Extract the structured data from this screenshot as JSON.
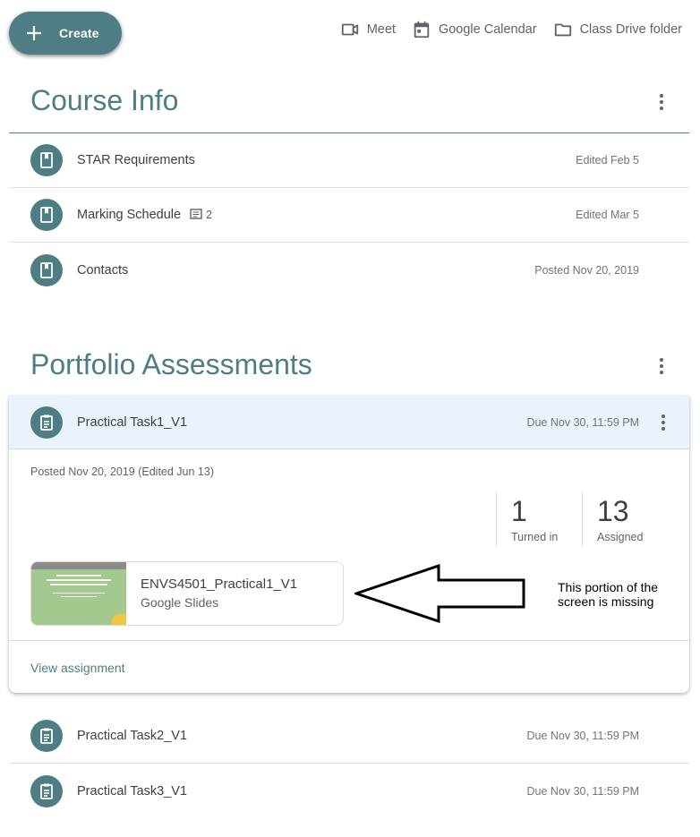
{
  "topbar": {
    "create_label": "Create",
    "links": [
      {
        "label": "Meet",
        "icon": "video-camera-icon"
      },
      {
        "label": "Google Calendar",
        "icon": "calendar-icon"
      },
      {
        "label": "Class Drive folder",
        "icon": "folder-icon"
      }
    ]
  },
  "course_info": {
    "title": "Course Info",
    "items": [
      {
        "title": "STAR Requirements",
        "meta": "Edited Feb 5",
        "comments": ""
      },
      {
        "title": "Marking Schedule",
        "meta": "Edited Mar 5",
        "comments": "2"
      },
      {
        "title": "Contacts",
        "meta": "Posted Nov 20, 2019",
        "comments": ""
      }
    ]
  },
  "portfolio": {
    "title": "Portfolio Assessments",
    "expanded": {
      "title": "Practical Task1_V1",
      "due": "Due Nov 30, 11:59 PM",
      "posted": "Posted Nov 20, 2019 (Edited Jun 13)",
      "turned_in_count": "1",
      "turned_in_label": "Turned in",
      "assigned_count": "13",
      "assigned_label": "Assigned",
      "attachment_name": "ENVS4501_Practical1_V1",
      "attachment_type": "Google Slides",
      "view_label": "View assignment"
    },
    "items": [
      {
        "title": "Practical Task2_V1",
        "due": "Due Nov 30, 11:59 PM"
      },
      {
        "title": "Practical Task3_V1",
        "due": "Due Nov 30, 11:59 PM"
      }
    ]
  },
  "annotation": {
    "note": "This portion of the screen is missing"
  },
  "colors": {
    "accent": "#4e7e83",
    "expanded_header_bg": "#e9f3fb",
    "text": "#3c4043",
    "muted": "#70757a"
  }
}
